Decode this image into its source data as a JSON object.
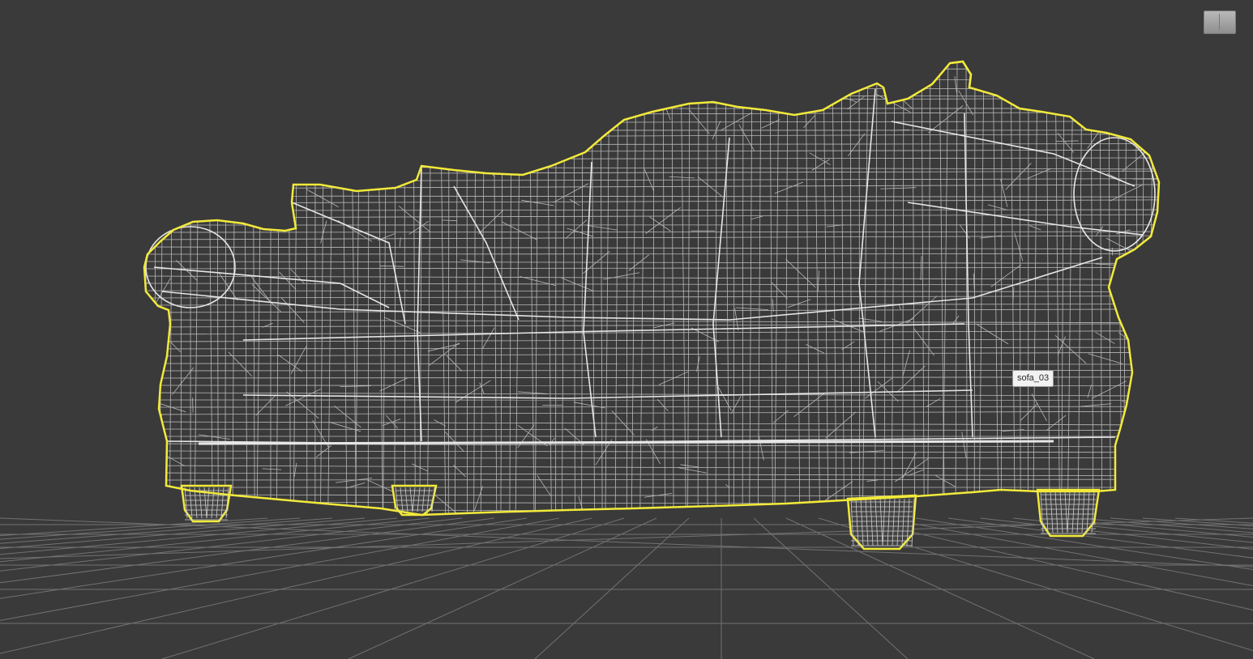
{
  "viewport": {
    "background_color": "#3a3a3a",
    "grid_color": "#6e6e6e",
    "wireframe_color": "#d4d4d4",
    "selection_outline_color": "#f2ea3a"
  },
  "selected_object": {
    "label": "sofa_03"
  },
  "viewcube": {
    "icon": "viewcube-icon",
    "left_face_label": "",
    "right_face_label": ""
  }
}
